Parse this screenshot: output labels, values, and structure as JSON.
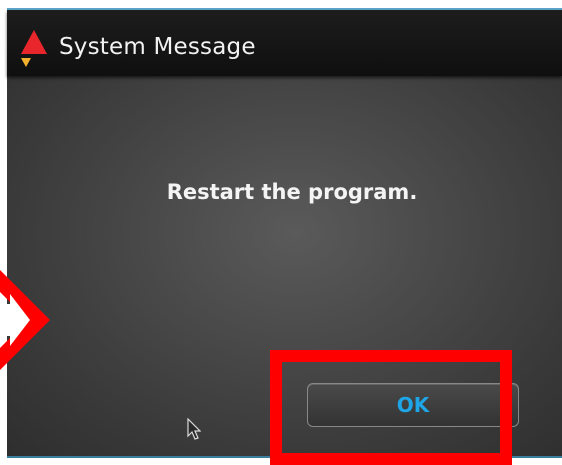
{
  "window": {
    "title": "System Message"
  },
  "dialog": {
    "message": "Restart the program.",
    "ok_label": "OK"
  },
  "icons": {
    "logo": "app-logo-icon",
    "cursor": "mouse-pointer-icon",
    "annotation_arrow": "arrow-right-icon"
  },
  "colors": {
    "title_bar": "#141414",
    "dialog_bg": "#454545",
    "ok_text": "#1ea6e6",
    "accent_border": "#5aa6c8",
    "annotation": "#ff0000"
  }
}
